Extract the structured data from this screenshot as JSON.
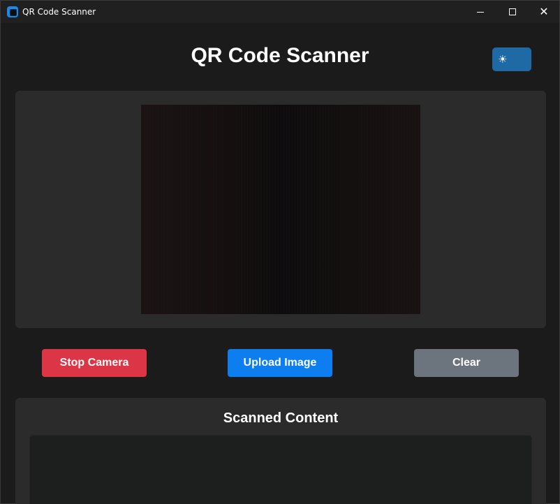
{
  "window": {
    "title": "QR Code Scanner",
    "controls": {
      "minimize": "",
      "maximize": "",
      "close": "✕"
    }
  },
  "header": {
    "title": "QR Code Scanner",
    "theme_toggle_icon": "☀"
  },
  "camera": {
    "feed_icon": "camera-feed"
  },
  "actions": {
    "stop_camera": "Stop Camera",
    "upload_image": "Upload Image",
    "clear": "Clear"
  },
  "scanned": {
    "heading": "Scanned Content",
    "content": ""
  },
  "colors": {
    "accent": "#1f6aa5",
    "stop": "#dc3545",
    "upload": "#0d7ef0",
    "clear": "#6c757d",
    "panel": "#2b2b2b",
    "background": "#1b1b1b"
  }
}
